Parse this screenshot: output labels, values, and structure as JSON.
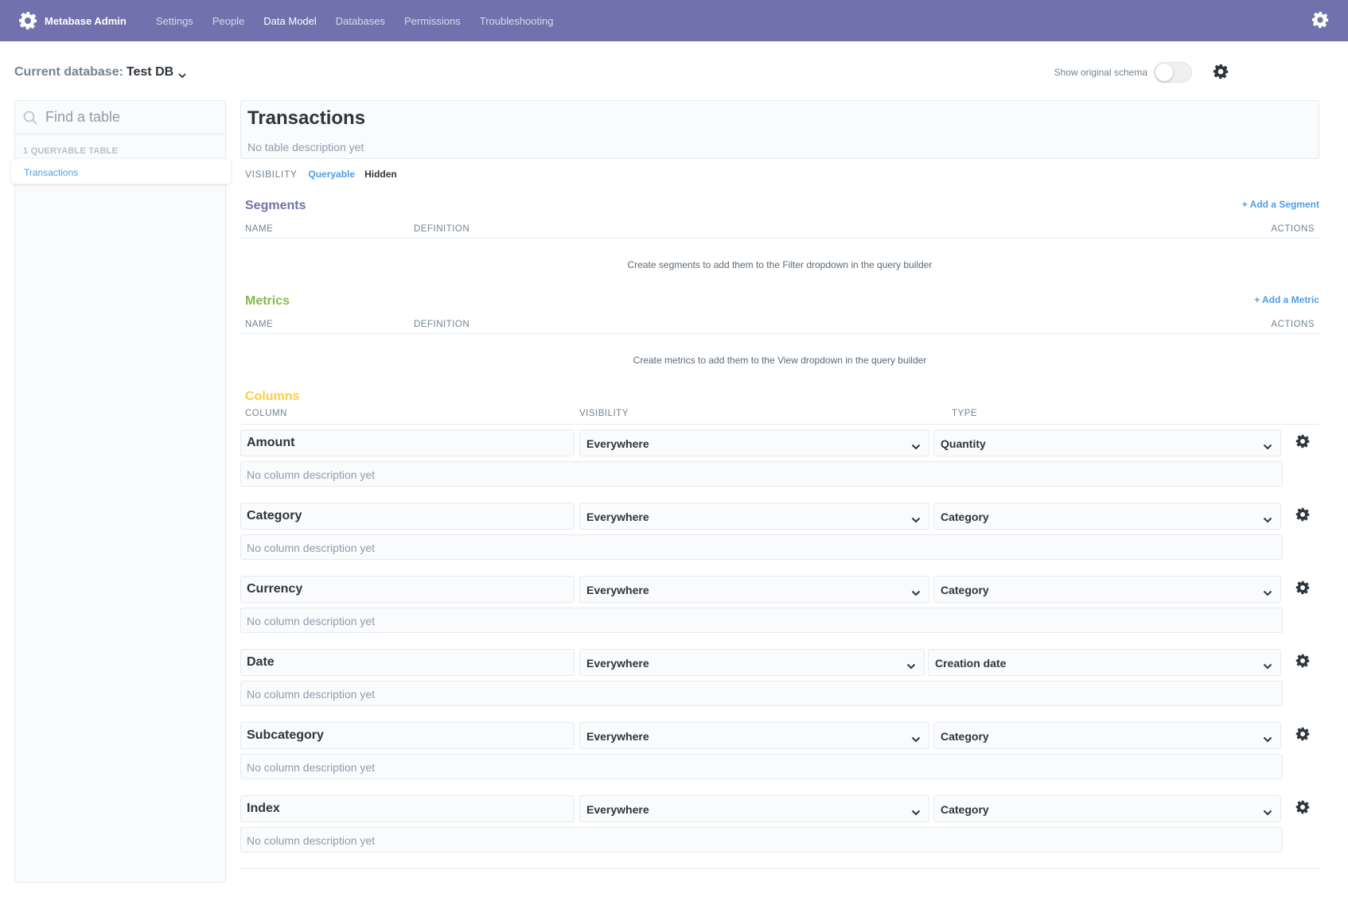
{
  "nav": {
    "brand": "Metabase Admin",
    "links": [
      "Settings",
      "People",
      "Data Model",
      "Databases",
      "Permissions",
      "Troubleshooting"
    ],
    "active": "Data Model"
  },
  "header": {
    "db_label": "Current database:",
    "db_name": "Test DB",
    "schema_toggle_label": "Show original schema"
  },
  "sidebar": {
    "search_placeholder": "Find a table",
    "count_label": "1 QUERYABLE TABLE",
    "items": [
      "Transactions"
    ]
  },
  "table": {
    "title": "Transactions",
    "description": "No table description yet",
    "visibility_label": "VISIBILITY",
    "visibility_options": [
      "Queryable",
      "Hidden"
    ]
  },
  "segments": {
    "title": "Segments",
    "add_label": "+ Add a Segment",
    "headers": [
      "NAME",
      "DEFINITION",
      "ACTIONS"
    ],
    "empty": "Create segments to add them to the Filter dropdown in the query builder"
  },
  "metrics": {
    "title": "Metrics",
    "add_label": "+ Add a Metric",
    "headers": [
      "NAME",
      "DEFINITION",
      "ACTIONS"
    ],
    "empty": "Create metrics to add them to the View dropdown in the query builder"
  },
  "columns": {
    "title": "Columns",
    "headers": [
      "COLUMN",
      "VISIBILITY",
      "TYPE"
    ],
    "rows": [
      {
        "name": "Amount",
        "visibility": "Everywhere",
        "type": "Quantity",
        "description": "No column description yet"
      },
      {
        "name": "Category",
        "visibility": "Everywhere",
        "type": "Category",
        "description": "No column description yet"
      },
      {
        "name": "Currency",
        "visibility": "Everywhere",
        "type": "Category",
        "description": "No column description yet"
      },
      {
        "name": "Date",
        "visibility": "Everywhere",
        "type": "Creation date",
        "description": "No column description yet"
      },
      {
        "name": "Subcategory",
        "visibility": "Everywhere",
        "type": "Category",
        "description": "No column description yet"
      },
      {
        "name": "Index",
        "visibility": "Everywhere",
        "type": "Category",
        "description": "No column description yet"
      }
    ]
  },
  "colors": {
    "nav_bg": "#7172ad",
    "segments": "#7172ad",
    "metrics": "#84bb4c",
    "columns": "#f9cf48",
    "link": "#509ee3"
  }
}
